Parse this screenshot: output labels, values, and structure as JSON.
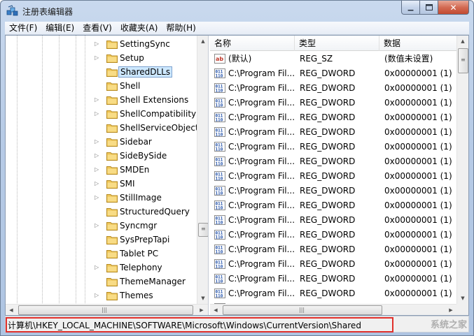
{
  "window": {
    "title": "注册表编辑器"
  },
  "menu": [
    {
      "label": "文件(F)"
    },
    {
      "label": "编辑(E)"
    },
    {
      "label": "查看(V)"
    },
    {
      "label": "收藏夹(A)"
    },
    {
      "label": "帮助(H)"
    }
  ],
  "tree": {
    "items": [
      {
        "label": "SettingSync",
        "expandable": true,
        "selected": false
      },
      {
        "label": "Setup",
        "expandable": true,
        "selected": false
      },
      {
        "label": "SharedDLLs",
        "expandable": false,
        "selected": true
      },
      {
        "label": "Shell",
        "expandable": false,
        "selected": false
      },
      {
        "label": "Shell Extensions",
        "expandable": true,
        "selected": false
      },
      {
        "label": "ShellCompatibility",
        "expandable": true,
        "selected": false
      },
      {
        "label": "ShellServiceObjectD",
        "expandable": false,
        "selected": false
      },
      {
        "label": "Sidebar",
        "expandable": true,
        "selected": false
      },
      {
        "label": "SideBySide",
        "expandable": true,
        "selected": false
      },
      {
        "label": "SMDEn",
        "expandable": true,
        "selected": false
      },
      {
        "label": "SMI",
        "expandable": true,
        "selected": false
      },
      {
        "label": "StillImage",
        "expandable": true,
        "selected": false
      },
      {
        "label": "StructuredQuery",
        "expandable": false,
        "selected": false
      },
      {
        "label": "Syncmgr",
        "expandable": true,
        "selected": false
      },
      {
        "label": "SysPrepTapi",
        "expandable": false,
        "selected": false
      },
      {
        "label": "Tablet PC",
        "expandable": false,
        "selected": false
      },
      {
        "label": "Telephony",
        "expandable": true,
        "selected": false
      },
      {
        "label": "ThemeManager",
        "expandable": false,
        "selected": false
      },
      {
        "label": "Themes",
        "expandable": true,
        "selected": false
      }
    ]
  },
  "list": {
    "columns": [
      "名称",
      "类型",
      "数据"
    ],
    "rows": [
      {
        "icon": "string-value-icon",
        "name": "(默认)",
        "type": "REG_SZ",
        "data": "(数值未设置)"
      },
      {
        "icon": "binary-value-icon",
        "name": "C:\\Program Fil...",
        "type": "REG_DWORD",
        "data": "0x00000001 (1)"
      },
      {
        "icon": "binary-value-icon",
        "name": "C:\\Program Fil...",
        "type": "REG_DWORD",
        "data": "0x00000001 (1)"
      },
      {
        "icon": "binary-value-icon",
        "name": "C:\\Program Fil...",
        "type": "REG_DWORD",
        "data": "0x00000001 (1)"
      },
      {
        "icon": "binary-value-icon",
        "name": "C:\\Program Fil...",
        "type": "REG_DWORD",
        "data": "0x00000001 (1)"
      },
      {
        "icon": "binary-value-icon",
        "name": "C:\\Program Fil...",
        "type": "REG_DWORD",
        "data": "0x00000001 (1)"
      },
      {
        "icon": "binary-value-icon",
        "name": "C:\\Program Fil...",
        "type": "REG_DWORD",
        "data": "0x00000001 (1)"
      },
      {
        "icon": "binary-value-icon",
        "name": "C:\\Program Fil...",
        "type": "REG_DWORD",
        "data": "0x00000001 (1)"
      },
      {
        "icon": "binary-value-icon",
        "name": "C:\\Program Fil...",
        "type": "REG_DWORD",
        "data": "0x00000001 (1)"
      },
      {
        "icon": "binary-value-icon",
        "name": "C:\\Program Fil...",
        "type": "REG_DWORD",
        "data": "0x00000001 (1)"
      },
      {
        "icon": "binary-value-icon",
        "name": "C:\\Program Fil...",
        "type": "REG_DWORD",
        "data": "0x00000001 (1)"
      },
      {
        "icon": "binary-value-icon",
        "name": "C:\\Program Fil...",
        "type": "REG_DWORD",
        "data": "0x00000001 (1)"
      },
      {
        "icon": "binary-value-icon",
        "name": "C:\\Program Fil...",
        "type": "REG_DWORD",
        "data": "0x00000001 (1)"
      },
      {
        "icon": "binary-value-icon",
        "name": "C:\\Program Fil...",
        "type": "REG_DWORD",
        "data": "0x00000001 (1)"
      },
      {
        "icon": "binary-value-icon",
        "name": "C:\\Program Fil...",
        "type": "REG_DWORD",
        "data": "0x00000001 (1)"
      },
      {
        "icon": "binary-value-icon",
        "name": "C:\\Program Fil...",
        "type": "REG_DWORD",
        "data": "0x00000001 (1)"
      },
      {
        "icon": "binary-value-icon",
        "name": "C:\\Program Fil...",
        "type": "REG_DWORD",
        "data": "0x00000001 (1)"
      },
      {
        "icon": "binary-value-icon",
        "name": "C:\\Program Fil...",
        "type": "REG_DWORD",
        "data": "0x00000001 (1)"
      }
    ]
  },
  "status": {
    "path": "计算机\\HKEY_LOCAL_MACHINE\\SOFTWARE\\Microsoft\\Windows\\CurrentVersion\\Shared",
    "watermark": "系统之家"
  },
  "colors": {
    "selection_fill": "#cde8ff",
    "highlight_border": "#e0302b",
    "close_button": "#c24a30"
  }
}
